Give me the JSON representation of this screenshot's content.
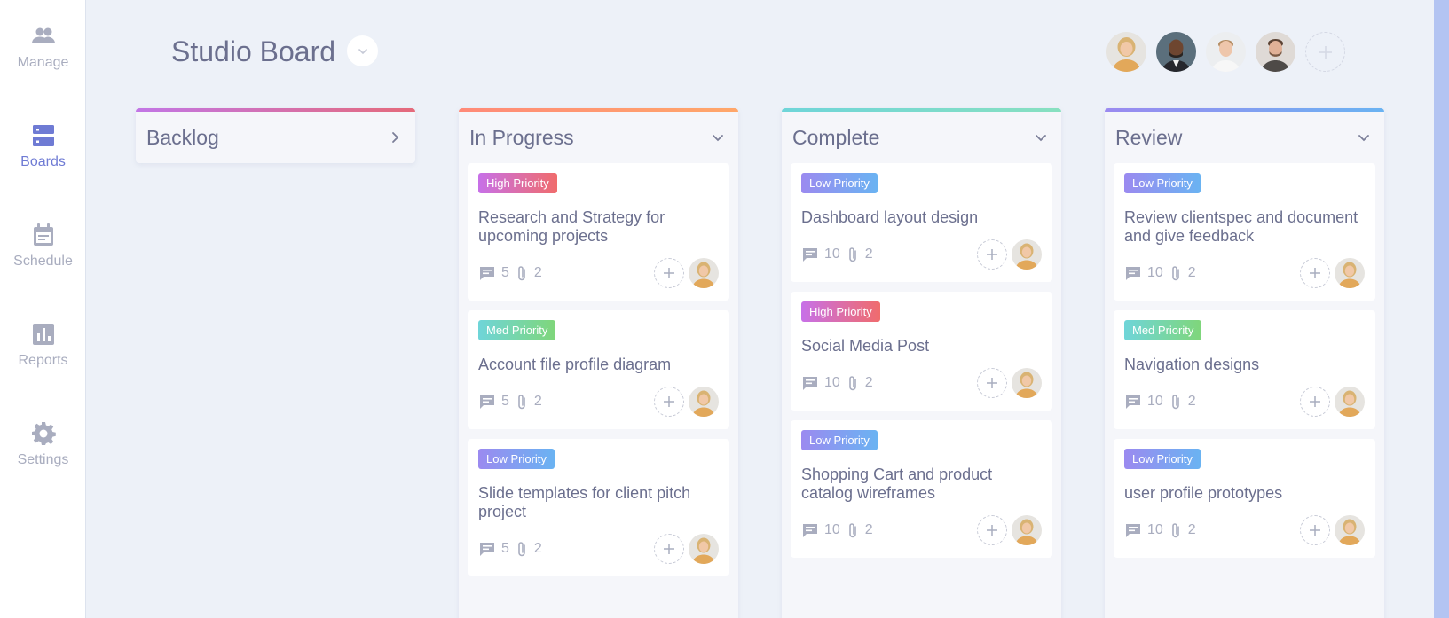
{
  "sidebar": {
    "items": [
      {
        "label": "Manage",
        "icon": "people-icon",
        "active": false
      },
      {
        "label": "Boards",
        "icon": "boards-icon",
        "active": true
      },
      {
        "label": "Schedule",
        "icon": "calendar-icon",
        "active": false
      },
      {
        "label": "Reports",
        "icon": "chart-icon",
        "active": false
      },
      {
        "label": "Settings",
        "icon": "gear-icon",
        "active": false
      }
    ]
  },
  "header": {
    "title": "Studio Board",
    "toggle_icon": "chevron-down-icon",
    "members": [
      "avatar-woman-blonde",
      "avatar-man-dark",
      "avatar-man-light",
      "avatar-man-beard"
    ],
    "add_member_icon": "plus-icon"
  },
  "columns": [
    {
      "title": "Backlog",
      "color_start": "#c276e6",
      "color_end": "#e56a7a",
      "collapsed": true,
      "cards": []
    },
    {
      "title": "In Progress",
      "color_start": "#ff8a78",
      "color_end": "#ffa76a",
      "collapsed": false,
      "cards": [
        {
          "badge": "High Priority",
          "badge_color_start": "#c770e8",
          "badge_color_end": "#f06c6c",
          "title": "Research and Strategy for upcoming projects",
          "comments": "5",
          "attachments": "2"
        },
        {
          "badge": "Med Priority",
          "badge_color_start": "#6fd5d9",
          "badge_color_end": "#7fd67a",
          "title": "Account file profile diagram",
          "comments": "5",
          "attachments": "2"
        },
        {
          "badge": "Low Priority",
          "badge_color_start": "#9b8af0",
          "badge_color_end": "#6ab3f2",
          "title": "Slide templates for client pitch project",
          "comments": "5",
          "attachments": "2"
        }
      ]
    },
    {
      "title": "Complete",
      "color_start": "#6fd5d9",
      "color_end": "#88e0c0",
      "collapsed": false,
      "cards": [
        {
          "badge": "Low Priority",
          "badge_color_start": "#9b8af0",
          "badge_color_end": "#6ab3f2",
          "title": "Dashboard layout design",
          "comments": "10",
          "attachments": "2"
        },
        {
          "badge": "High Priority",
          "badge_color_start": "#c770e8",
          "badge_color_end": "#f06c6c",
          "title": "Social Media Post",
          "comments": "10",
          "attachments": "2"
        },
        {
          "badge": "Low Priority",
          "badge_color_start": "#9b8af0",
          "badge_color_end": "#6ab3f2",
          "title": "Shopping Cart and product catalog wireframes",
          "comments": "10",
          "attachments": "2"
        }
      ]
    },
    {
      "title": "Review",
      "color_start": "#9b8af0",
      "color_end": "#6ab3f2",
      "collapsed": false,
      "cards": [
        {
          "badge": "Low Priority",
          "badge_color_start": "#9b8af0",
          "badge_color_end": "#6ab3f2",
          "title": "Review clientspec and document and give feedback",
          "comments": "10",
          "attachments": "2"
        },
        {
          "badge": "Med Priority",
          "badge_color_start": "#6fd5d9",
          "badge_color_end": "#7fd67a",
          "title": "Navigation designs",
          "comments": "10",
          "attachments": "2"
        },
        {
          "badge": "Low Priority",
          "badge_color_start": "#9b8af0",
          "badge_color_end": "#6ab3f2",
          "title": "user profile prototypes",
          "comments": "10",
          "attachments": "2"
        }
      ]
    }
  ],
  "colors": {
    "accent": "#6f7bd4",
    "background": "#edf1f8",
    "text": "#6b6f8e",
    "muted": "#a9adbf"
  }
}
